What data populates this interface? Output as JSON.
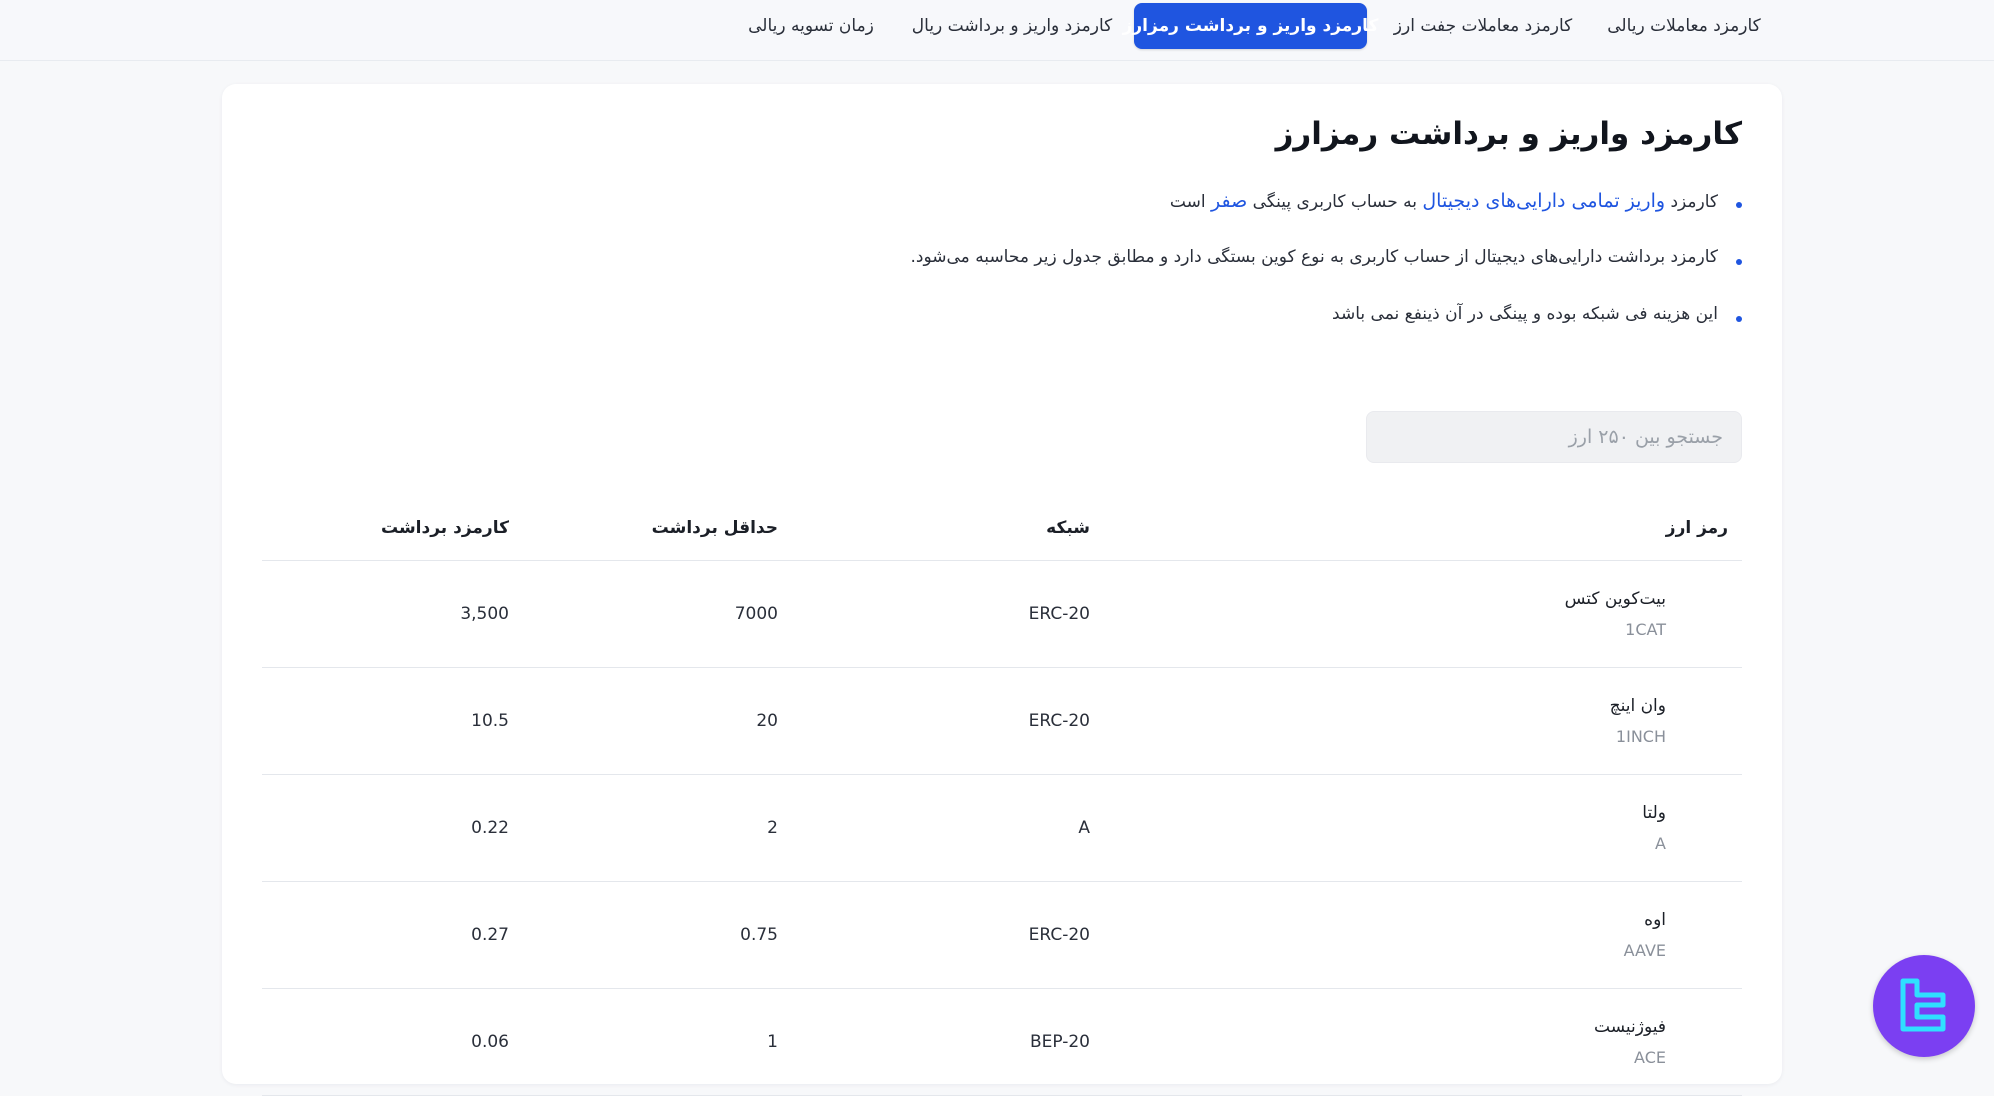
{
  "tabs": [
    {
      "label": "کارمزد معاملات ریالی",
      "active": false
    },
    {
      "label": "کارمزد معاملات جفت ارز",
      "active": false
    },
    {
      "label": "کارمزد واریز و برداشت رمزارز",
      "active": true
    },
    {
      "label": "کارمزد واریز و برداشت ریال",
      "active": false
    },
    {
      "label": "زمان تسویه ریالی",
      "active": false
    }
  ],
  "title": "کارمزد واریز و برداشت رمزارز",
  "bullets": {
    "b1": {
      "t1": "کارمزد ",
      "t2": "واریز تمامی دارایی‌های دیجیتال",
      "t3": " به حساب کاربری پینگی ",
      "t4": "صفر",
      "t5": " است"
    },
    "b2": "کارمزد برداشت دارایی‌های دیجیتال از حساب کاربری به نوع کوین بستگی دارد و مطابق جدول زیر محاسبه می‌شود.",
    "b3": "این هزینه فی شبکه بوده و پینگی در آن ذینفع نمی باشد"
  },
  "search": {
    "placeholder": "جستجو بین ۲۵۰ ارز"
  },
  "table": {
    "headers": {
      "symbol": "رمز ارز",
      "network": "شبکه",
      "min_withdraw": "حداقل برداشت",
      "fee": "کارمزد برداشت"
    },
    "rows": [
      {
        "name": "بیت‌کوین کتس",
        "symbol": "1CAT",
        "network": "ERC-20",
        "min": "7000",
        "fee": "3,500"
      },
      {
        "name": "وان اینچ",
        "symbol": "1INCH",
        "network": "ERC-20",
        "min": "20",
        "fee": "10.5"
      },
      {
        "name": "ولتا",
        "symbol": "A",
        "network": "A",
        "min": "2",
        "fee": "0.22"
      },
      {
        "name": "اوه",
        "symbol": "AAVE",
        "network": "ERC-20",
        "min": "0.75",
        "fee": "0.27"
      },
      {
        "name": "فیوژنیست",
        "symbol": "ACE",
        "network": "BEP-20",
        "min": "1",
        "fee": "0.06"
      }
    ]
  },
  "colors": {
    "accent": "#1f55e0",
    "logo_bg": "#7b3ff2",
    "logo_fg": "#2fe0ff"
  },
  "icons": {
    "logo": "tradingfinder-logo-icon"
  }
}
